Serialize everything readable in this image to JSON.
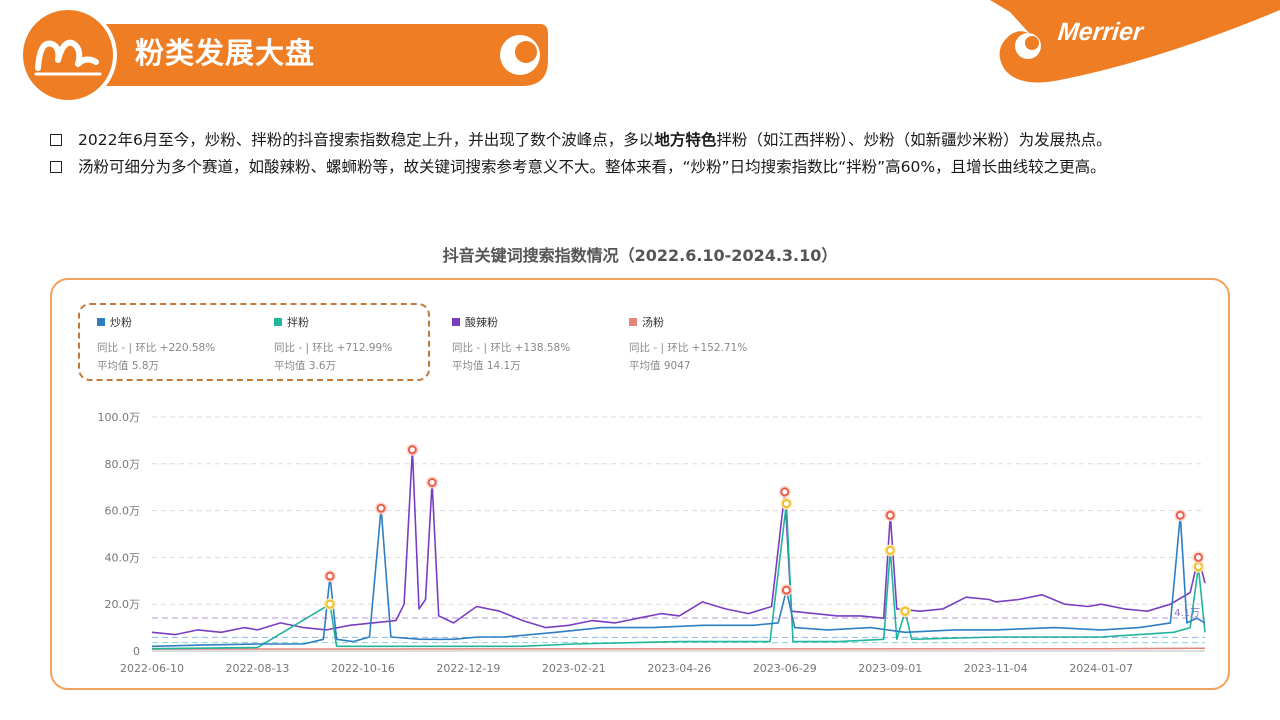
{
  "header": {
    "title": "粉类发展大盘",
    "brand": "Merrier",
    "colors": {
      "accent": "#ee7d24",
      "accent_dark": "#e06a12"
    }
  },
  "bullets": [
    {
      "before": "2022年6月至今，炒粉、拌粉的抖音搜索指数稳定上升，并出现了数个波峰点，多以",
      "bold": "地方特色",
      "after": "拌粉（如江西拌粉）、炒粉（如新疆炒米粉）为发展热点。"
    },
    {
      "before": "汤粉可细分为多个赛道，如酸辣粉、螺蛳粉等，故关键词搜索参考意义不大。整体来看，“炒粉”日均搜索指数比“拌粉”高60%，且增长曲线较之更高。",
      "bold": "",
      "after": ""
    }
  ],
  "chart_title": "抖音关键词搜索指数情况（2022.6.10-2024.3.10）",
  "legend": [
    {
      "name": "炒粉",
      "color": "#2f7ec2",
      "ratio": "同比 - | 环比 +220.58%",
      "avg": "平均值 5.8万"
    },
    {
      "name": "拌粉",
      "color": "#20b59c",
      "ratio": "同比 - | 环比 +712.99%",
      "avg": "平均值 3.6万"
    },
    {
      "name": "酸辣粉",
      "color": "#7a3fc0",
      "ratio": "同比 - | 环比 +138.58%",
      "avg": "平均值 14.1万"
    },
    {
      "name": "汤粉",
      "color": "#e5857a",
      "ratio": "同比 - | 环比 +152.71%",
      "avg": "平均值 9047"
    }
  ],
  "chart_data": {
    "type": "line",
    "xlabel": "",
    "ylabel": "",
    "x_ticks": [
      "2022-06-10",
      "2022-08-13",
      "2022-10-16",
      "2022-12-19",
      "2023-02-21",
      "2023-04-26",
      "2023-06-29",
      "2023-09-01",
      "2023-11-04",
      "2024-01-07"
    ],
    "y_ticks": [
      "0",
      "20.0万",
      "40.0万",
      "60.0万",
      "80.0万",
      "100.0万"
    ],
    "ylim": [
      0,
      100
    ],
    "grid": true,
    "avg_line_label": "4.1万",
    "series": [
      {
        "name": "炒粉",
        "color": "#2f7ec2",
        "points": [
          [
            "2022-06-10",
            2
          ],
          [
            "2022-07-10",
            2.5
          ],
          [
            "2022-08-13",
            3
          ],
          [
            "2022-09-10",
            3
          ],
          [
            "2022-09-22",
            5
          ],
          [
            "2022-09-26",
            32
          ],
          [
            "2022-09-30",
            5
          ],
          [
            "2022-10-10",
            4
          ],
          [
            "2022-10-20",
            6
          ],
          [
            "2022-10-27",
            61
          ],
          [
            "2022-11-02",
            6
          ],
          [
            "2022-11-20",
            5
          ],
          [
            "2022-12-10",
            5
          ],
          [
            "2022-12-25",
            6
          ],
          [
            "2023-01-10",
            6
          ],
          [
            "2023-02-10",
            8
          ],
          [
            "2023-03-10",
            10
          ],
          [
            "2023-04-10",
            10
          ],
          [
            "2023-05-10",
            11
          ],
          [
            "2023-06-10",
            11
          ],
          [
            "2023-06-25",
            12
          ],
          [
            "2023-06-30",
            26
          ],
          [
            "2023-07-05",
            10
          ],
          [
            "2023-07-25",
            9
          ],
          [
            "2023-08-20",
            10
          ],
          [
            "2023-09-10",
            8
          ],
          [
            "2023-10-10",
            9
          ],
          [
            "2023-11-04",
            9
          ],
          [
            "2023-12-10",
            10
          ],
          [
            "2024-01-07",
            9
          ],
          [
            "2024-01-30",
            10
          ],
          [
            "2024-02-18",
            12
          ],
          [
            "2024-02-24",
            58
          ],
          [
            "2024-02-28",
            12
          ],
          [
            "2024-03-05",
            14
          ],
          [
            "2024-03-10",
            12
          ]
        ]
      },
      {
        "name": "拌粉",
        "color": "#20b59c",
        "points": [
          [
            "2022-06-10",
            1
          ],
          [
            "2022-08-13",
            1.5
          ],
          [
            "2022-09-26",
            20
          ],
          [
            "2022-09-30",
            2
          ],
          [
            "2022-10-16",
            2
          ],
          [
            "2022-12-19",
            2
          ],
          [
            "2023-01-20",
            2
          ],
          [
            "2023-02-21",
            3
          ],
          [
            "2023-04-26",
            4
          ],
          [
            "2023-06-20",
            4
          ],
          [
            "2023-06-30",
            63
          ],
          [
            "2023-07-04",
            4
          ],
          [
            "2023-08-01",
            4
          ],
          [
            "2023-08-28",
            5
          ],
          [
            "2023-09-01",
            43
          ],
          [
            "2023-09-05",
            5
          ],
          [
            "2023-09-10",
            17
          ],
          [
            "2023-09-14",
            5
          ],
          [
            "2023-11-04",
            6
          ],
          [
            "2024-01-07",
            6
          ],
          [
            "2024-02-20",
            8
          ],
          [
            "2024-03-01",
            10
          ],
          [
            "2024-03-06",
            36
          ],
          [
            "2024-03-10",
            8
          ]
        ]
      },
      {
        "name": "酸辣粉",
        "color": "#7a3fc0",
        "points": [
          [
            "2022-06-10",
            8
          ],
          [
            "2022-06-24",
            7
          ],
          [
            "2022-07-08",
            9
          ],
          [
            "2022-07-22",
            8
          ],
          [
            "2022-08-05",
            10
          ],
          [
            "2022-08-13",
            9
          ],
          [
            "2022-08-27",
            12
          ],
          [
            "2022-09-10",
            10
          ],
          [
            "2022-09-24",
            9
          ],
          [
            "2022-10-08",
            11
          ],
          [
            "2022-10-22",
            12
          ],
          [
            "2022-11-05",
            13
          ],
          [
            "2022-11-10",
            20
          ],
          [
            "2022-11-15",
            86
          ],
          [
            "2022-11-19",
            18
          ],
          [
            "2022-11-23",
            22
          ],
          [
            "2022-11-27",
            72
          ],
          [
            "2022-12-01",
            15
          ],
          [
            "2022-12-10",
            12
          ],
          [
            "2022-12-24",
            19
          ],
          [
            "2023-01-07",
            17
          ],
          [
            "2023-01-21",
            13
          ],
          [
            "2023-02-04",
            10
          ],
          [
            "2023-02-18",
            11
          ],
          [
            "2023-03-04",
            13
          ],
          [
            "2023-03-18",
            12
          ],
          [
            "2023-04-01",
            14
          ],
          [
            "2023-04-15",
            16
          ],
          [
            "2023-04-26",
            15
          ],
          [
            "2023-05-10",
            21
          ],
          [
            "2023-05-24",
            18
          ],
          [
            "2023-06-07",
            16
          ],
          [
            "2023-06-21",
            19
          ],
          [
            "2023-06-29",
            68
          ],
          [
            "2023-07-03",
            17
          ],
          [
            "2023-07-17",
            16
          ],
          [
            "2023-07-31",
            15
          ],
          [
            "2023-08-14",
            15
          ],
          [
            "2023-08-28",
            14
          ],
          [
            "2023-09-01",
            58
          ],
          [
            "2023-09-05",
            18
          ],
          [
            "2023-09-19",
            17
          ],
          [
            "2023-10-03",
            18
          ],
          [
            "2023-10-17",
            23
          ],
          [
            "2023-10-31",
            22
          ],
          [
            "2023-11-04",
            21
          ],
          [
            "2023-11-18",
            22
          ],
          [
            "2023-12-02",
            24
          ],
          [
            "2023-12-16",
            20
          ],
          [
            "2023-12-30",
            19
          ],
          [
            "2024-01-07",
            20
          ],
          [
            "2024-01-21",
            18
          ],
          [
            "2024-02-04",
            17
          ],
          [
            "2024-02-18",
            20
          ],
          [
            "2024-03-01",
            25
          ],
          [
            "2024-03-06",
            40
          ],
          [
            "2024-03-10",
            29
          ]
        ]
      },
      {
        "name": "汤粉",
        "color": "#e5857a",
        "points": [
          [
            "2022-06-10",
            0.8
          ],
          [
            "2022-12-19",
            0.9
          ],
          [
            "2023-06-29",
            0.9
          ],
          [
            "2024-01-07",
            1.0
          ],
          [
            "2024-03-10",
            1.2
          ]
        ]
      }
    ]
  }
}
